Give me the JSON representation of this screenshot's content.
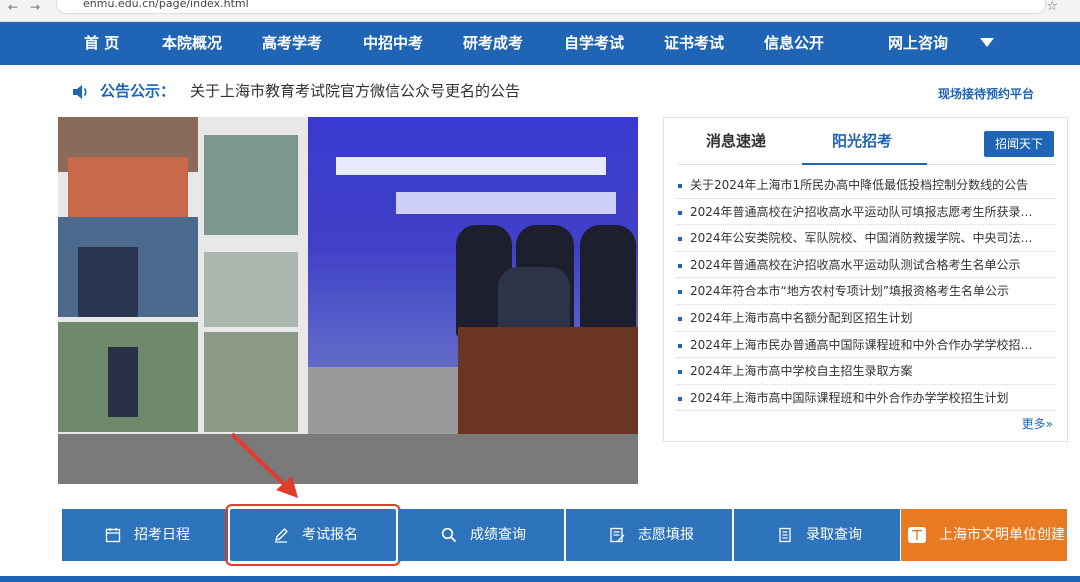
{
  "browser": {
    "url": "enmu.edu.cn/page/index.html"
  },
  "nav": {
    "items": [
      "首 页",
      "本院概况",
      "高考学考",
      "中招中考",
      "研考成考",
      "自学考试",
      "证书考试",
      "信息公开",
      "网上咨询"
    ]
  },
  "notice": {
    "label": "公告公示：",
    "text": "关于上海市教育考试院官方微信公众号更名的公告",
    "reception": "现场接待预约平台"
  },
  "news_panel": {
    "tabs": [
      "消息速递",
      "阳光招考"
    ],
    "active_tab": 1,
    "button": "招闻天下",
    "items": [
      "关于2024年上海市1所民办高中降低最低投档控制分数线的公告",
      "2024年普通高校在沪招收高水平运动队可填报志愿考生所获录…",
      "2024年公安类院校、军队院校、中国消防救援学院、中央司法…",
      "2024年普通高校在沪招收高水平运动队测试合格考生名单公示",
      "2024年符合本市“地方农村专项计划”填报资格考生名单公示",
      "2024年上海市高中名额分配到区招生计划",
      "2024年上海市民办普通高中国际课程班和中外合作办学学校招…",
      "2024年上海市高中学校自主招生录取方案",
      "2024年上海市高中国际课程班和中外合作办学学校招生计划"
    ],
    "more": "更多»"
  },
  "services": [
    {
      "label": "招考日程",
      "icon": "calendar-icon"
    },
    {
      "label": "考试报名",
      "icon": "pencil-icon"
    },
    {
      "label": "成绩查询",
      "icon": "search-icon"
    },
    {
      "label": "志愿填报",
      "icon": "form-icon"
    },
    {
      "label": "录取查询",
      "icon": "document-icon"
    },
    {
      "label": "上海市文明单位创建",
      "icon": "book-icon"
    }
  ],
  "colors": {
    "primary": "#1f64b5",
    "service": "#2e74bd",
    "orange": "#e87a22",
    "highlight": "#e23c2e"
  }
}
